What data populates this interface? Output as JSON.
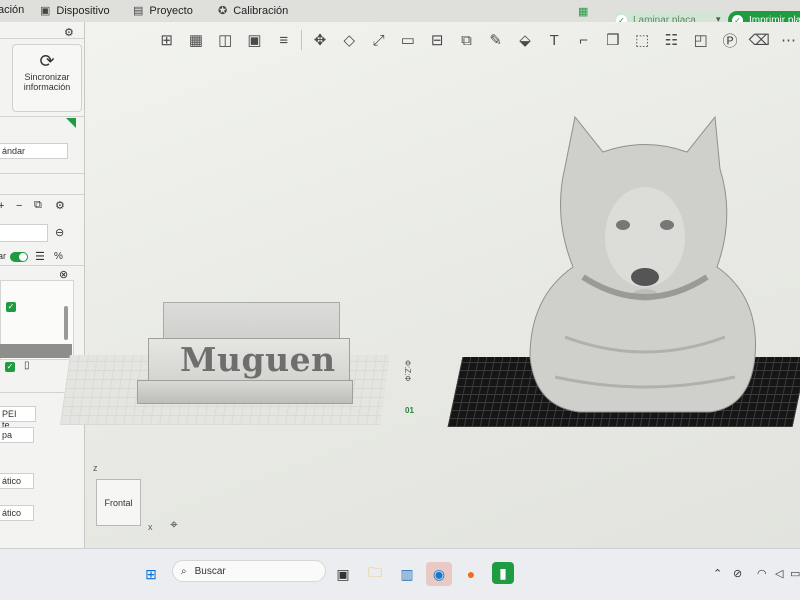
{
  "menu": {
    "items": [
      {
        "label": "ación",
        "icon": "none"
      },
      {
        "label": "Dispositivo",
        "icon": "device-icon"
      },
      {
        "label": "Proyecto",
        "icon": "project-icon"
      },
      {
        "label": "Calibración",
        "icon": "calibration-icon"
      }
    ],
    "slice_label": "Laminar placa",
    "print_label": "Imprimir pla"
  },
  "sidebar": {
    "sync_label": "Sincronizar información",
    "profile_value": "ándar",
    "search_value": "",
    "toggle_label": "ar",
    "plate_type_value": "PEI te...",
    "layer_value": "pa",
    "support_value_1": "ático",
    "support_value_2": "ático",
    "zoom_icon": "%"
  },
  "viewport": {
    "plaque_text": "Muguen",
    "view_cube_label": "Frontal",
    "axis_z": "z",
    "axis_x": "x",
    "plate_index": "01",
    "plate_count_vertical": "Ф:Z:Ф"
  },
  "taskbar": {
    "search_placeholder": "Buscar",
    "colors": {
      "accent": "#1f9b42",
      "edge": "#0a7bd4",
      "firefox": "#f36b1c"
    }
  }
}
